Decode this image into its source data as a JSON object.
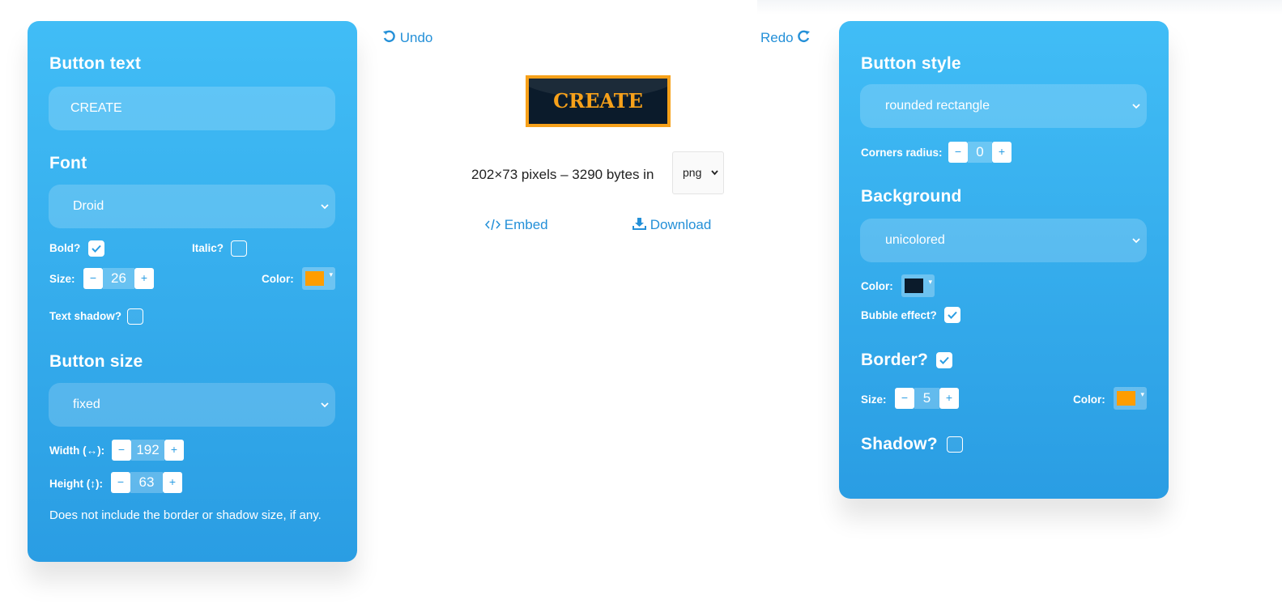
{
  "toolbar": {
    "undo_label": "Undo",
    "redo_label": "Redo"
  },
  "left": {
    "button_text_heading": "Button text",
    "button_text_value": "CREATE",
    "font_heading": "Font",
    "font_value": "Droid",
    "bold_label": "Bold?",
    "bold_checked": true,
    "italic_label": "Italic?",
    "italic_checked": false,
    "size_label": "Size:",
    "size_value": "26",
    "color_label": "Color:",
    "text_color": "#ff9d00",
    "text_shadow_label": "Text shadow?",
    "text_shadow_checked": false,
    "button_size_heading": "Button size",
    "button_size_value": "fixed",
    "width_label": "Width (↔):",
    "width_value": "192",
    "height_label": "Height (↕):",
    "height_value": "63",
    "note": "Does not include the border or shadow size, if any."
  },
  "center": {
    "preview_text": "CREATE",
    "info_text": "202×73 pixels – 3290 bytes in",
    "format_value": "png",
    "embed_label": "Embed",
    "download_label": "Download"
  },
  "right": {
    "button_style_heading": "Button style",
    "button_style_value": "rounded rectangle",
    "corners_label": "Corners radius:",
    "corners_value": "0",
    "background_heading": "Background",
    "background_value": "unicolored",
    "color_label": "Color:",
    "background_color": "#0b1b2b",
    "bubble_label": "Bubble effect?",
    "bubble_checked": true,
    "border_heading": "Border?",
    "border_checked": true,
    "border_size_label": "Size:",
    "border_size_value": "5",
    "border_color_label": "Color:",
    "border_color": "#ff9d00",
    "shadow_heading": "Shadow?",
    "shadow_checked": false
  },
  "stepper": {
    "minus": "−",
    "plus": "+"
  },
  "icons": {
    "chevron": "⌄",
    "dropdown_arrow": "▾"
  }
}
